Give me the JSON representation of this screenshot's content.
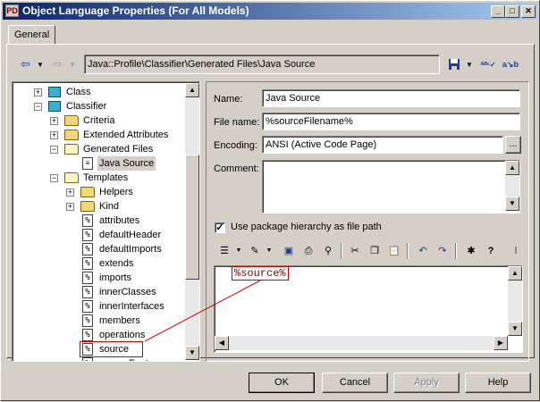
{
  "window": {
    "title": "Object Language Properties (For All Models)"
  },
  "tabs": [
    {
      "label": "General"
    }
  ],
  "nav": {
    "path": "Java::Profile\\Classifier\\Generated Files\\Java Source"
  },
  "tree": {
    "items": [
      {
        "label": "Class",
        "icon": "class-icon"
      },
      {
        "label": "Classifier",
        "icon": "class-icon"
      },
      {
        "label": "Criteria",
        "icon": "folder-icon"
      },
      {
        "label": "Extended Attributes",
        "icon": "folder-icon"
      },
      {
        "label": "Generated Files",
        "icon": "folder-icon"
      },
      {
        "label": "Java Source",
        "icon": "file-icon"
      },
      {
        "label": "Templates",
        "icon": "folder-icon"
      },
      {
        "label": "Helpers",
        "icon": "folder-icon"
      },
      {
        "label": "Kind",
        "icon": "folder-icon"
      },
      {
        "label": "attributes",
        "icon": "template-icon"
      },
      {
        "label": "defaultHeader",
        "icon": "template-icon"
      },
      {
        "label": "defaultImports",
        "icon": "template-icon"
      },
      {
        "label": "extends",
        "icon": "template-icon"
      },
      {
        "label": "imports",
        "icon": "template-icon"
      },
      {
        "label": "innerClasses",
        "icon": "template-icon"
      },
      {
        "label": "innerInterfaces",
        "icon": "template-icon"
      },
      {
        "label": "members",
        "icon": "template-icon"
      },
      {
        "label": "operations",
        "icon": "template-icon"
      },
      {
        "label": "source",
        "icon": "template-icon"
      },
      {
        "label": "sourceFooter",
        "icon": "template-icon"
      }
    ]
  },
  "form": {
    "name_label": "Name:",
    "name_value": "Java Source",
    "filename_label": "File name:",
    "filename_value": "%sourceFilename%",
    "encoding_label": "Encoding:",
    "encoding_value": "ANSI (Active Code Page)",
    "encoding_button": "...",
    "comment_label": "Comment:",
    "comment_value": "",
    "package_checkbox_label": "Use package hierarchy as file path",
    "package_checkbox_checked": true
  },
  "editor": {
    "content": "%source%"
  },
  "buttons": {
    "ok": "OK",
    "cancel": "Cancel",
    "apply": "Apply",
    "help": "Help"
  },
  "colors": {
    "titlebar_start": "#0a246a",
    "titlebar_end": "#a6caf0",
    "highlight_box": "#d00000",
    "code_text": "#800000"
  }
}
